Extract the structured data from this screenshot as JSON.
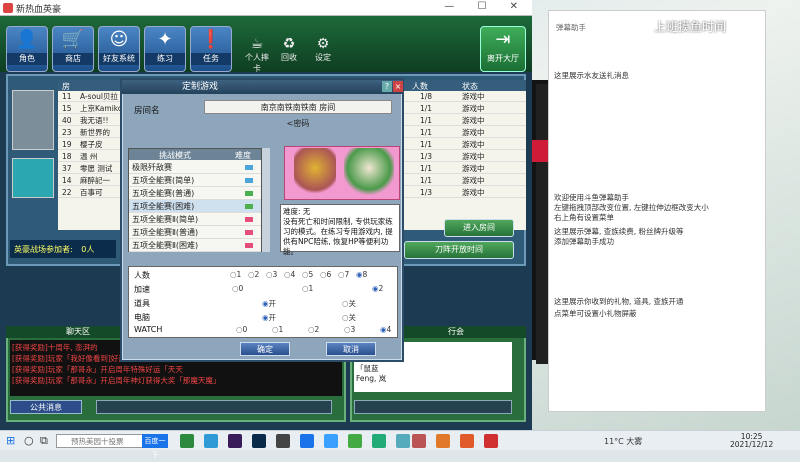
{
  "window": {
    "title": "新热血英豪"
  },
  "toolbar": {
    "buttons": [
      {
        "label": "角色",
        "icon": "character-icon"
      },
      {
        "label": "商店",
        "icon": "cart-icon"
      },
      {
        "label": "好友系统",
        "icon": "friends-icon"
      },
      {
        "label": "练习",
        "icon": "practice-icon"
      },
      {
        "label": "任务",
        "icon": "task-icon"
      }
    ],
    "small_buttons": [
      {
        "label": "个人摔卡",
        "icon": "coffee-icon"
      },
      {
        "label": "回收",
        "icon": "recycle-icon"
      },
      {
        "label": "设定",
        "icon": "settings-gear-icon"
      }
    ],
    "exit_label": "离开大厅"
  },
  "room_table": {
    "headers": {
      "num": "房",
      "players": "人数",
      "status": "状态"
    },
    "rows": [
      {
        "no": "11",
        "name": "A-soul贝拉",
        "players": "1/8",
        "status": "游戏中"
      },
      {
        "no": "15",
        "name": "上京Kamiko",
        "players": "1/1",
        "status": "游戏中"
      },
      {
        "no": "40",
        "name": "我无语!!",
        "players": "1/1",
        "status": "游戏中"
      },
      {
        "no": "23",
        "name": "新世界的",
        "players": "1/1",
        "status": "游戏中"
      },
      {
        "no": "19",
        "name": "樱子皮",
        "players": "1/1",
        "status": "游戏中"
      },
      {
        "no": "18",
        "name": "温 州",
        "players": "1/3",
        "status": "游戏中"
      },
      {
        "no": "37",
        "name": "零愿 测试",
        "players": "1/1",
        "status": "游戏中"
      },
      {
        "no": "14",
        "name": "麻醉記一",
        "players": "1/1",
        "status": "游戏中"
      },
      {
        "no": "22",
        "name": "百事可",
        "players": "1/3",
        "status": "游戏中"
      }
    ]
  },
  "battle_field": {
    "label": "英豪战场参加者:",
    "count": "0人"
  },
  "right_buttons": {
    "enter": "进入房间",
    "quick": "刀阵开放时间"
  },
  "dialog": {
    "title": "定制游戏",
    "room_name_label": "房间名",
    "room_name_value": "南京南铁南铁南 房间",
    "password_label": "<密码",
    "mode_header": "挑战模式",
    "mode_header2": "难度",
    "modes": [
      {
        "label": "极限歼敌赛",
        "color": "#4aa5d8"
      },
      {
        "label": "五项全能赛(简单)",
        "color": "#4aa5d8"
      },
      {
        "label": "五项全能赛(普通)",
        "color": "#4caf50"
      },
      {
        "label": "五项全能赛(困难)",
        "color": "#4caf50"
      },
      {
        "label": "五项全能赛Ⅱ(简单)",
        "color": "#e34f7a"
      },
      {
        "label": "五项全能赛Ⅱ(普通)",
        "color": "#e34f7a"
      },
      {
        "label": "五项全能赛Ⅱ(困难)",
        "color": "#e34f7a"
      }
    ],
    "description": "难度: 无\n没有死亡和时间限制, 专供玩家练习的模式。在练习专用游戏内, 提供有NPC陪练, 恢复HP等便利功能。",
    "options": {
      "people": {
        "label": "人数",
        "values": [
          "1",
          "2",
          "3",
          "4",
          "5",
          "6",
          "7",
          "8"
        ],
        "selected": "8"
      },
      "speed": {
        "label": "加速",
        "values": [
          "0",
          "1",
          "2"
        ],
        "selected": "2"
      },
      "items": {
        "label": "道具",
        "values": [
          "开",
          "关"
        ],
        "selected": "开"
      },
      "cpu": {
        "label": "电脑",
        "values": [
          "开",
          "关"
        ],
        "selected": "开"
      },
      "watch": {
        "label": "WATCH",
        "values": [
          "0",
          "1",
          "2",
          "3",
          "4"
        ],
        "selected": "4"
      }
    },
    "ok": "确定",
    "cancel": "取消"
  },
  "chat": {
    "title": "聊天区",
    "lines": [
      "[获得奖励]十周年, 澎湃的",
      "[获得奖励]玩家「我好像看到]好运「天天",
      "[获得奖励]玩家「那哥永」开启周年特殊好运「天天",
      "[获得奖励]玩家「那哥永」开启周年神灯获得大奖「那魔天魔」"
    ],
    "public_label": "公共消息"
  },
  "players": {
    "title": "行会",
    "tab": "点点宁",
    "list": [
      "点点宁",
      "开阳",
      "「鼠蓝",
      "Feng, 岚"
    ]
  },
  "side": {
    "clock": "上班摸鱼时间",
    "title": "弹幕助手",
    "lines": [
      "这里展示水友送礼消息",
      "欢迎使用斗鱼弹幕助手",
      "左键拖拽顶部改变位置, 左键拉伸边框改变大小",
      "右上角有设置菜单",
      "这里展示弹幕, 查族续费, 粉丝牌升级等",
      "添加弹幕助手成功",
      "这里展示你收到的礼物, 道具, 查族开通",
      "点菜单可设置小礼物屏蔽"
    ]
  },
  "taskbar": {
    "search_placeholder": "预热美园十投票",
    "search_btn": "百度一下",
    "weather": "11°C 大雾",
    "time": "10:25",
    "date": "2021/12/12"
  }
}
